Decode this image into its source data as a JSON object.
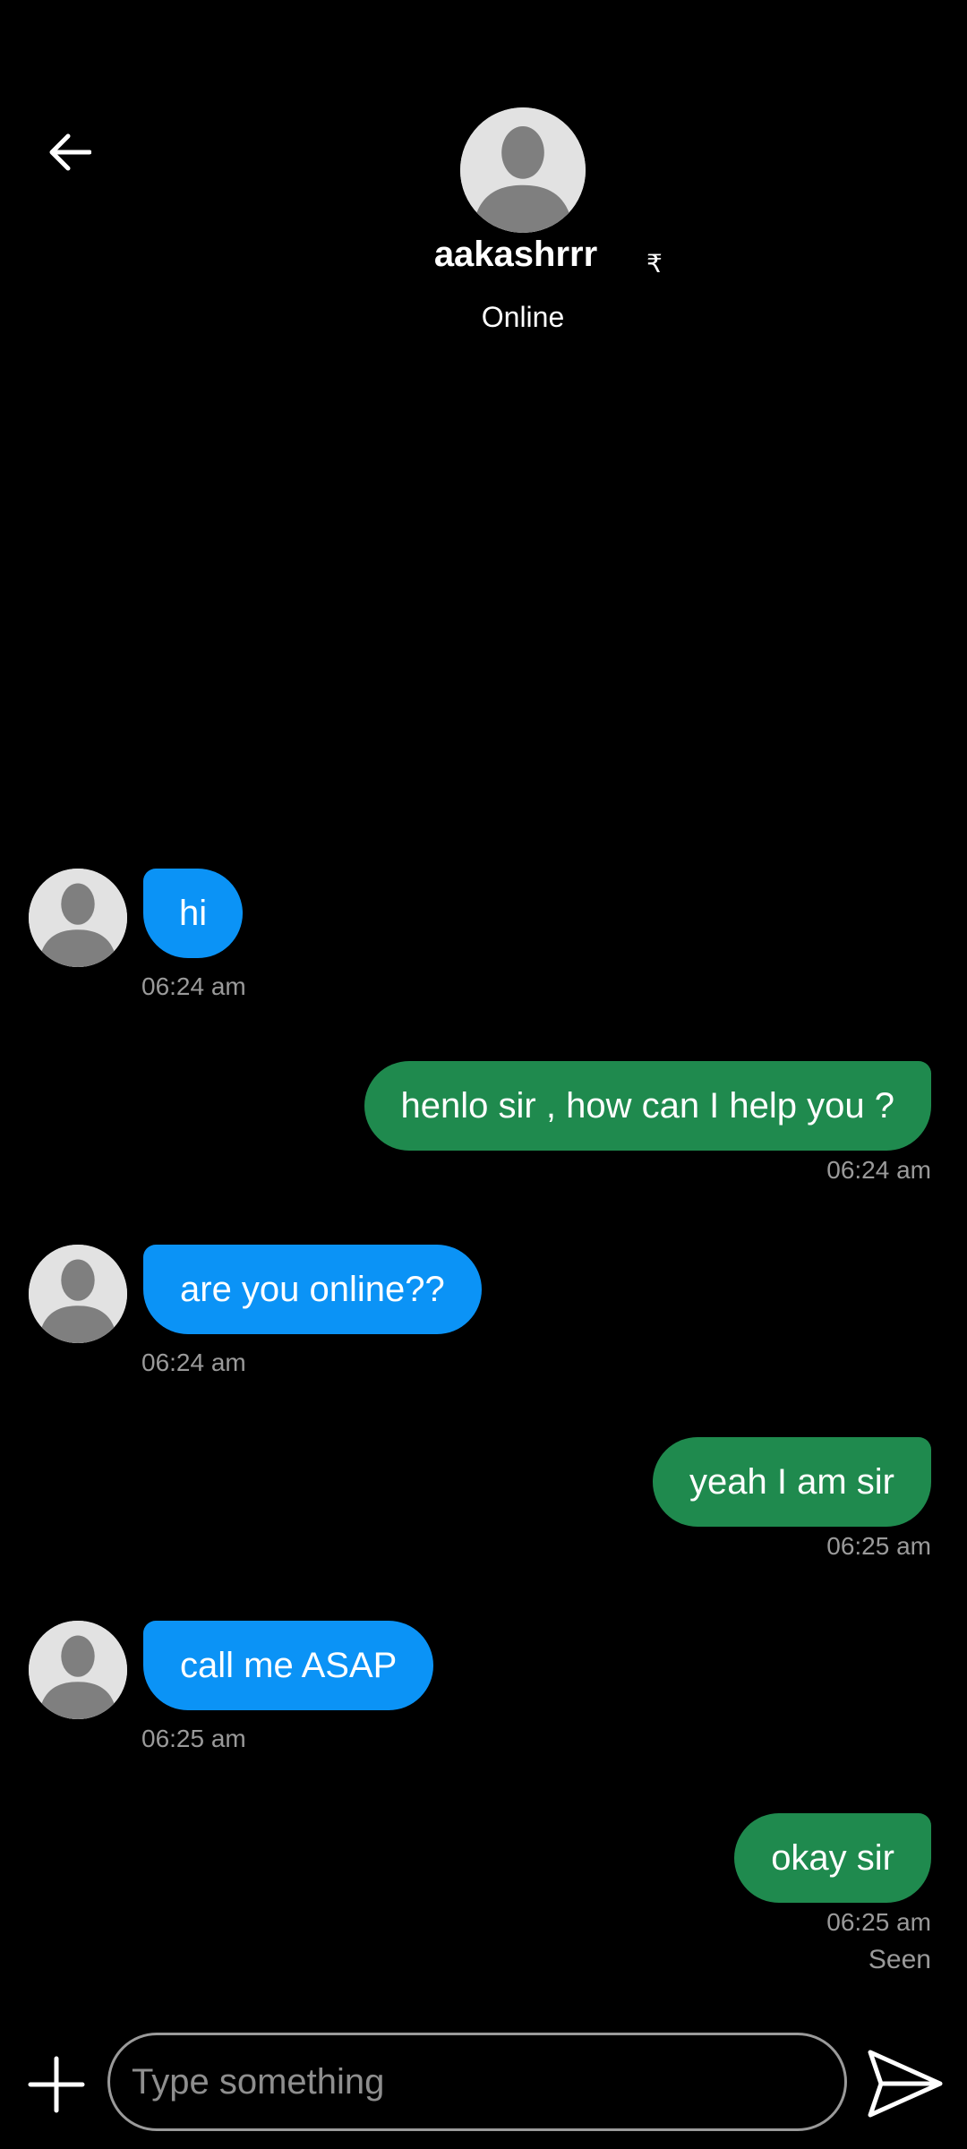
{
  "header": {
    "username": "aakashrrr",
    "currency_symbol": "₹",
    "status": "Online"
  },
  "messages": [
    {
      "direction": "incoming",
      "text": "hi",
      "time": "06:24 am"
    },
    {
      "direction": "outgoing",
      "text": "henlo sir , how can I help you ?",
      "time": "06:24 am"
    },
    {
      "direction": "incoming",
      "text": "are you online??",
      "time": "06:24 am"
    },
    {
      "direction": "outgoing",
      "text": "yeah I am sir",
      "time": "06:25 am"
    },
    {
      "direction": "incoming",
      "text": "call me ASAP",
      "time": "06:25 am"
    },
    {
      "direction": "outgoing",
      "text": "okay sir",
      "time": "06:25 am"
    }
  ],
  "last_message_status": "Seen",
  "composer": {
    "placeholder": "Type something"
  },
  "icons": {
    "back": "arrow-left-icon",
    "add": "plus-icon",
    "send": "send-icon",
    "avatar": "default-avatar-icon"
  },
  "colors": {
    "background": "#000000",
    "incoming_bubble": "#0b93f6",
    "outgoing_bubble": "#1f8a4e",
    "timestamp": "#9a9a9a"
  }
}
